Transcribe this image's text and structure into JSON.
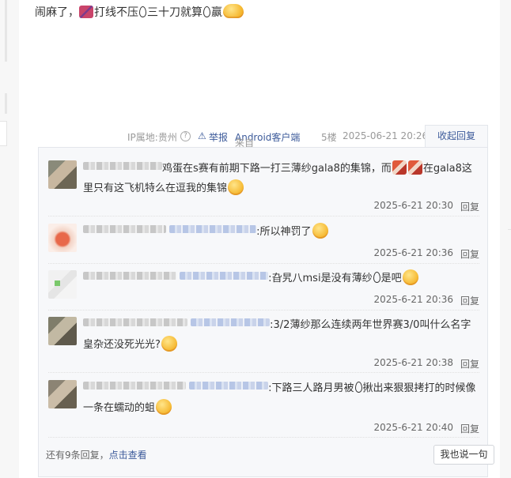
{
  "post": {
    "text_part1": "闹麻了，",
    "text_part2": "打线不压",
    "text_part3": "三十刀就算",
    "text_part4": "赢"
  },
  "meta": {
    "ip_label": "IP属地:贵州",
    "help_icon": "?",
    "warn_icon": "⚠",
    "report": "举报",
    "from_prefix": "来自",
    "from_client": "Android客户端",
    "floor": "5楼",
    "time": "2025-06-21 20:26",
    "collapse": "收起回复"
  },
  "replies": [
    {
      "text_a": "鸡蛋在s赛有前期下路一打三薄纱gala8的集锦，而",
      "text_b": "在gala8这里只有这飞机特么在逗我的集锦",
      "time": "2025-6-21 20:30",
      "reply_label": "回复"
    },
    {
      "text": ":所以神罚了",
      "time": "2025-6-21 20:36",
      "reply_label": "回复"
    },
    {
      "text_a": ":旮旯八msi是没有薄纱",
      "text_b": "是吧",
      "time": "2025-6-21 20:36",
      "reply_label": "回复"
    },
    {
      "text": ":3/2薄纱那么连续两年世界赛3/0叫什么名字皇杂还没死光光?",
      "time": "2025-6-21 20:38",
      "reply_label": "回复"
    },
    {
      "text_a": ":下路三人路月男被",
      "text_b": "揪出来狠狠拷打的时候像一条在蠕动的蛆",
      "time": "2025-6-21 20:40",
      "reply_label": "回复"
    }
  ],
  "footer": {
    "more_prefix": "还有9条回复，",
    "more_link": "点击查看",
    "say_button": "我也说一句"
  },
  "icons": {
    "emoji": "smiley-face-icon",
    "gift": "gift-icon",
    "egg": "egg-outline-icon",
    "sticker": "meat-sticker-icon",
    "help": "help-circle-icon",
    "warn": "warning-triangle-icon"
  },
  "colors": {
    "link": "#3c5a9a",
    "meta_text": "#999999",
    "reply_bg": "#f7f8fa"
  }
}
